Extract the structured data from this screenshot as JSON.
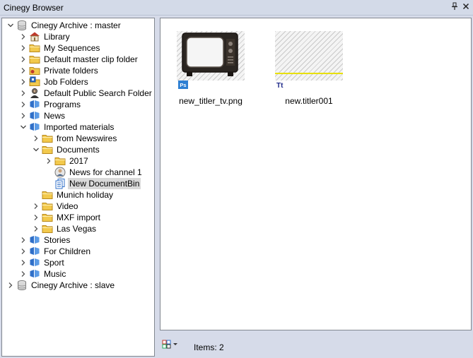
{
  "window": {
    "title": "Cinegy Browser",
    "pin_glyph": "⚓",
    "close_glyph": "✕"
  },
  "tree": [
    {
      "label": "Cinegy Archive : master",
      "level": 0,
      "expanded": true,
      "icon": "database-icon"
    },
    {
      "label": "Library",
      "level": 1,
      "expanded": false,
      "icon": "library-icon"
    },
    {
      "label": "My Sequences",
      "level": 1,
      "expanded": false,
      "icon": "folder-icon"
    },
    {
      "label": "Default master clip folder",
      "level": 1,
      "expanded": false,
      "icon": "folder-icon"
    },
    {
      "label": "Private folders",
      "level": 1,
      "expanded": false,
      "icon": "private-folder-icon"
    },
    {
      "label": "Job Folders",
      "level": 1,
      "expanded": false,
      "icon": "job-folder-icon"
    },
    {
      "label": "Default Public Search Folder",
      "level": 1,
      "expanded": false,
      "icon": "search-folder-icon"
    },
    {
      "label": "Programs",
      "level": 1,
      "expanded": false,
      "icon": "cube-icon"
    },
    {
      "label": "News",
      "level": 1,
      "expanded": false,
      "icon": "cube-icon"
    },
    {
      "label": "Imported materials",
      "level": 1,
      "expanded": true,
      "icon": "cube-icon"
    },
    {
      "label": "from Newswires",
      "level": 2,
      "expanded": false,
      "icon": "folder-icon"
    },
    {
      "label": "Documents",
      "level": 2,
      "expanded": true,
      "icon": "folder-icon"
    },
    {
      "label": "2017",
      "level": 3,
      "expanded": false,
      "icon": "folder-icon"
    },
    {
      "label": "News for channel 1",
      "level": 3,
      "expanded": null,
      "icon": "news-person-icon"
    },
    {
      "label": "New DocumentBin",
      "level": 3,
      "expanded": null,
      "icon": "document-bin-icon",
      "selected": true
    },
    {
      "label": "Munich holiday",
      "level": 2,
      "expanded": null,
      "icon": "folder-icon"
    },
    {
      "label": "Video",
      "level": 2,
      "expanded": false,
      "icon": "folder-icon"
    },
    {
      "label": "MXF import",
      "level": 2,
      "expanded": false,
      "icon": "folder-icon"
    },
    {
      "label": "Las Vegas",
      "level": 2,
      "expanded": false,
      "icon": "folder-icon"
    },
    {
      "label": "Stories",
      "level": 1,
      "expanded": false,
      "icon": "cube-icon"
    },
    {
      "label": "For Children",
      "level": 1,
      "expanded": false,
      "icon": "cube-icon"
    },
    {
      "label": "Sport",
      "level": 1,
      "expanded": false,
      "icon": "cube-icon"
    },
    {
      "label": "Music",
      "level": 1,
      "expanded": false,
      "icon": "cube-icon"
    },
    {
      "label": "Cinegy Archive : slave",
      "level": 0,
      "expanded": false,
      "icon": "database-icon"
    }
  ],
  "content": {
    "items": [
      {
        "name": "new_titler_tv.png",
        "badge": "Ps",
        "badge_icon": "photoshop-icon",
        "thumb": "tv-thumbnail"
      },
      {
        "name": "new.titler001",
        "badge": "Tt",
        "badge_icon": "titler-icon",
        "thumb": "titler-thumbnail"
      }
    ]
  },
  "status": {
    "items_label": "Items: 2"
  },
  "colors": {
    "folder": "#f2c94c",
    "cube": "#2f6fc8",
    "selection": "#d9d9d9",
    "ps_badge": "#2d7fd3",
    "titler_badge": "#1f2a8a",
    "titler_line": "#e8e000"
  }
}
